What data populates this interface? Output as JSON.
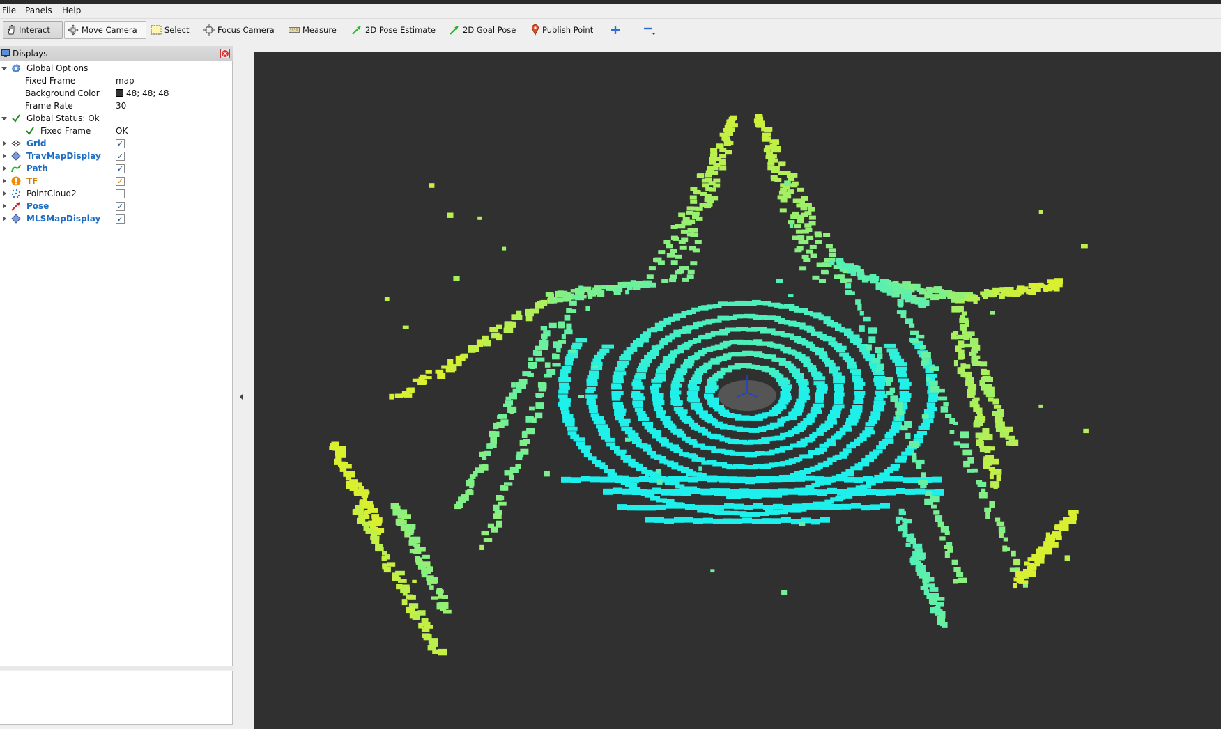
{
  "menu": {
    "file": {
      "label": "File"
    },
    "panels": {
      "label": "Panels"
    },
    "help": {
      "label": "Help"
    }
  },
  "toolbar": {
    "interact": "Interact",
    "move_camera": "Move Camera",
    "select": "Select",
    "focus_camera": "Focus Camera",
    "measure": "Measure",
    "pose_estimate": "2D Pose Estimate",
    "goal_pose": "2D Goal Pose",
    "publish_point": "Publish Point"
  },
  "displays_panel": {
    "title": "Displays",
    "global_options": {
      "label": "Global Options",
      "fixed_frame_label": "Fixed Frame",
      "fixed_frame_value": "map",
      "background_color_label": "Background Color",
      "background_color_value": "48; 48; 48",
      "background_color_hex": "#303030",
      "frame_rate_label": "Frame Rate",
      "frame_rate_value": "30"
    },
    "global_status": {
      "label": "Global Status: Ok",
      "fixed_frame_label": "Fixed Frame",
      "fixed_frame_value": "OK"
    },
    "items": [
      {
        "label": "Grid",
        "checked": true,
        "icon": "grid-icon"
      },
      {
        "label": "TravMapDisplay",
        "checked": true,
        "icon": "diamond-icon"
      },
      {
        "label": "Path",
        "checked": true,
        "icon": "path-icon"
      },
      {
        "label": "TF",
        "checked": true,
        "icon": "warning-icon"
      },
      {
        "label": "PointCloud2",
        "checked": false,
        "icon": "pointcloud-icon"
      },
      {
        "label": "Pose",
        "checked": true,
        "icon": "pose-arrow-icon"
      },
      {
        "label": "MLSMapDisplay",
        "checked": true,
        "icon": "diamond-icon"
      }
    ]
  },
  "colors": {
    "viewport_background": "#303030",
    "point_near": "#19f0f0",
    "point_far": "#d8f030",
    "link_blue": "#1d6cc4",
    "warn_orange": "#c77a00"
  }
}
